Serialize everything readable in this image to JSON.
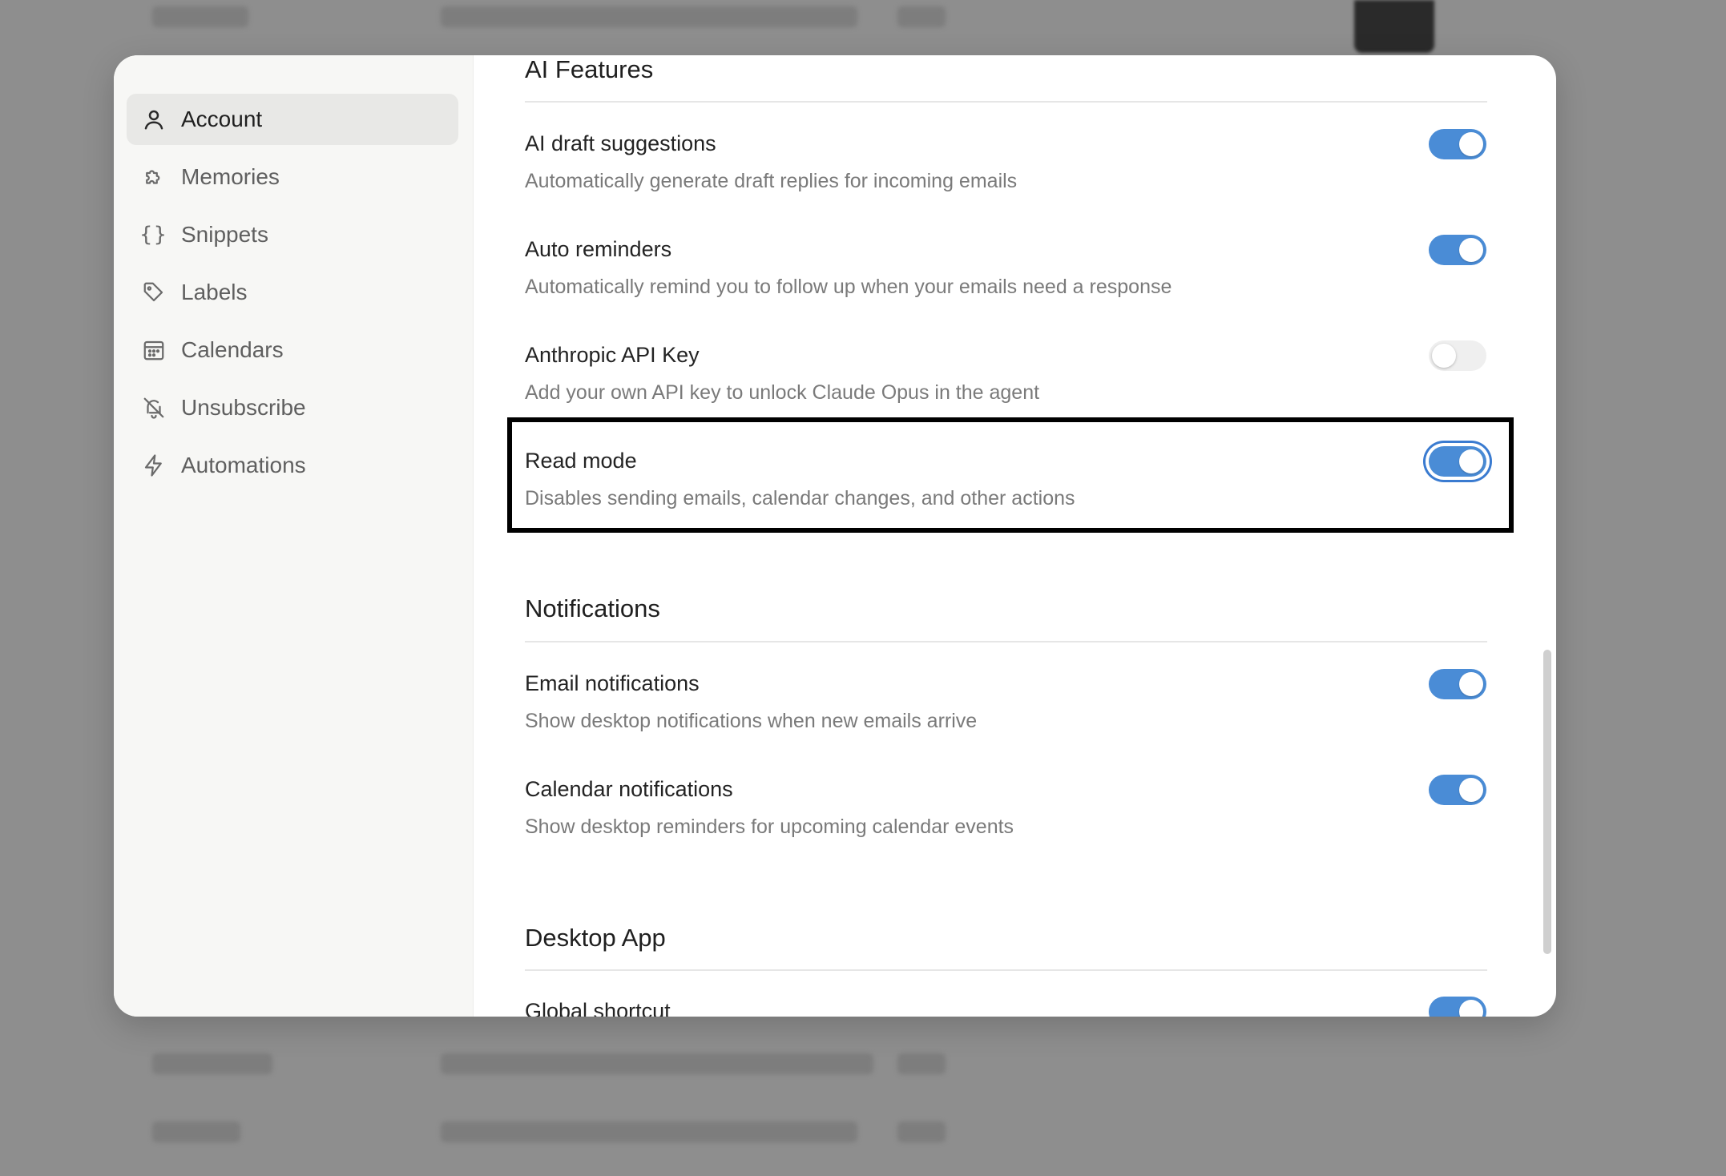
{
  "sidebar": {
    "items": [
      {
        "label": "Account",
        "icon": "user-icon",
        "active": true
      },
      {
        "label": "Memories",
        "icon": "puzzle-icon",
        "active": false
      },
      {
        "label": "Snippets",
        "icon": "braces-icon",
        "active": false
      },
      {
        "label": "Labels",
        "icon": "tag-icon",
        "active": false
      },
      {
        "label": "Calendars",
        "icon": "calendar-icon",
        "active": false
      },
      {
        "label": "Unsubscribe",
        "icon": "bell-off-icon",
        "active": false
      },
      {
        "label": "Automations",
        "icon": "bolt-icon",
        "active": false
      }
    ]
  },
  "sections": {
    "ai": {
      "title": "AI Features",
      "settings": [
        {
          "title": "AI draft suggestions",
          "desc": "Automatically generate draft replies for incoming emails",
          "enabled": true
        },
        {
          "title": "Auto reminders",
          "desc": "Automatically remind you to follow up when your emails need a response",
          "enabled": true
        },
        {
          "title": "Anthropic API Key",
          "desc": "Add your own API key to unlock Claude Opus in the agent",
          "enabled": false
        },
        {
          "title": "Read mode",
          "desc": "Disables sending emails, calendar changes, and other actions",
          "enabled": true
        }
      ]
    },
    "notifications": {
      "title": "Notifications",
      "settings": [
        {
          "title": "Email notifications",
          "desc": "Show desktop notifications when new emails arrive",
          "enabled": true
        },
        {
          "title": "Calendar notifications",
          "desc": "Show desktop reminders for upcoming calendar events",
          "enabled": true
        }
      ]
    },
    "desktop": {
      "title": "Desktop App",
      "settings": [
        {
          "title": "Global shortcut",
          "enabled": true
        }
      ]
    }
  },
  "colors": {
    "toggle_on": "#4a8cd6",
    "toggle_off": "#efefef",
    "highlight": "#000000"
  }
}
